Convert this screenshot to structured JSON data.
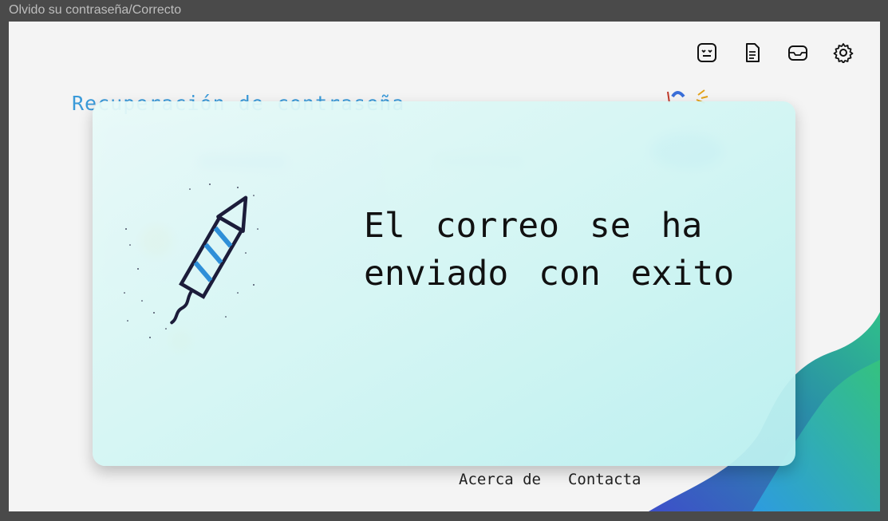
{
  "window": {
    "title": "Olvido su contraseña/Correcto"
  },
  "toolbar": {
    "icons": [
      "face-icon",
      "document-icon",
      "inbox-icon",
      "settings-icon"
    ]
  },
  "page": {
    "heading": "Recuperación de contraseña"
  },
  "modal": {
    "message": "El correo se ha enviado con exito"
  },
  "footer": {
    "about": "Acerca de",
    "contact": "Contacta"
  },
  "colors": {
    "heading": "#3a9ad9",
    "modal_bg": "#d0f5f3",
    "rocket_stripe": "#2f8fd8",
    "rocket_outline": "#1c1c3a"
  }
}
